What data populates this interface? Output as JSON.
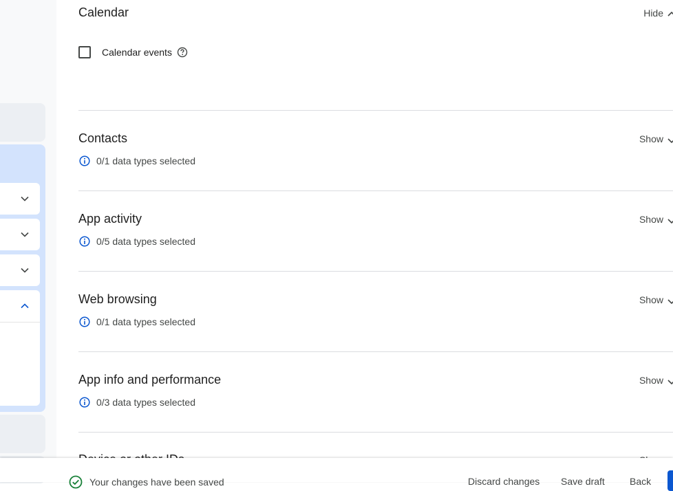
{
  "colors": {
    "accent": "#0b57d0",
    "info_icon": "#0b57d0",
    "ok_icon": "#188038",
    "sidebar_highlight": "#d3e3fd"
  },
  "sections": [
    {
      "title": "Calendar",
      "toggle": "Hide",
      "checkbox": {
        "label": "Calendar events",
        "checked": false,
        "help_icon": "help-circle-icon"
      }
    },
    {
      "title": "Contacts",
      "toggle": "Show",
      "info": "0/1 data types selected",
      "info_icon": "info-icon"
    },
    {
      "title": "App activity",
      "toggle": "Show",
      "info": "0/5 data types selected",
      "info_icon": "info-icon"
    },
    {
      "title": "Web browsing",
      "toggle": "Show",
      "info": "0/1 data types selected",
      "info_icon": "info-icon"
    },
    {
      "title": "App info and performance",
      "toggle": "Show",
      "info": "0/3 data types selected",
      "info_icon": "info-icon"
    },
    {
      "title": "Device or other IDs",
      "toggle": "Show"
    }
  ],
  "sidebar": {
    "items": [
      {
        "icon": "chevron-down-icon",
        "expanded": false
      },
      {
        "icon": "chevron-down-icon",
        "expanded": false
      },
      {
        "icon": "chevron-down-icon",
        "expanded": false
      },
      {
        "icon": "chevron-up-icon",
        "expanded": true
      }
    ]
  },
  "footer": {
    "status": "Your changes have been saved",
    "discard": "Discard changes",
    "save_draft": "Save draft",
    "back": "Back"
  }
}
